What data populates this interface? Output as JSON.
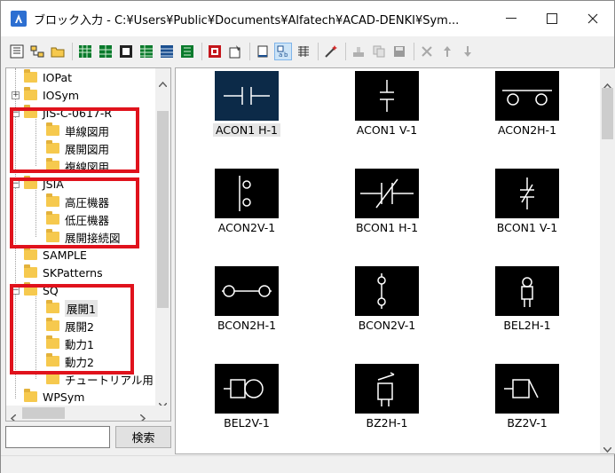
{
  "window": {
    "title": "ブロック入力 - C:¥Users¥Public¥Documents¥Alfatech¥ACAD-DENKI¥Sym...",
    "buttons": [
      "minimize",
      "maximize",
      "close"
    ]
  },
  "toolbar": {
    "icons": [
      "open-library-icon",
      "tree-icon",
      "folder-open-icon",
      "green-grid-icon-1",
      "green-grid-icon-2",
      "green-grid-icon-3",
      "green-grid-icon-4",
      "green-grid-icon-5",
      "green-grid-icon-6",
      "red-grid-icon",
      "properties-icon",
      "page-icon",
      "small-thumbnails-icon",
      "list-icon",
      "wand-icon",
      "stamp-icon",
      "copy-icon",
      "save-icon",
      "delete-icon",
      "up-arrow-icon",
      "down-arrow-icon"
    ]
  },
  "tree": {
    "items": [
      {
        "label": "IOPat",
        "level": 1
      },
      {
        "label": "IOSym",
        "level": 1
      },
      {
        "label": "JIS-C-0617-R",
        "level": 1
      },
      {
        "label": "単線図用",
        "level": 2
      },
      {
        "label": "展開図用",
        "level": 2
      },
      {
        "label": "複線図用",
        "level": 2
      },
      {
        "label": "JSIA",
        "level": 1
      },
      {
        "label": "高圧機器",
        "level": 2
      },
      {
        "label": "低圧機器",
        "level": 2
      },
      {
        "label": "展開接続図",
        "level": 2
      },
      {
        "label": "SAMPLE",
        "level": 1
      },
      {
        "label": "SKPatterns",
        "level": 1
      },
      {
        "label": "SQ",
        "level": 1
      },
      {
        "label": "展開1",
        "level": 2
      },
      {
        "label": "展開2",
        "level": 2
      },
      {
        "label": "動力1",
        "level": 2
      },
      {
        "label": "動力2",
        "level": 2
      },
      {
        "label": "チュートリアル用",
        "level": 2
      },
      {
        "label": "WPSym",
        "level": 1
      }
    ],
    "selected": "展開1"
  },
  "search": {
    "value": "",
    "button_label": "検索"
  },
  "grid": {
    "items": [
      {
        "label": "ACON1 H-1"
      },
      {
        "label": "ACON1 V-1"
      },
      {
        "label": "ACON2H-1"
      },
      {
        "label": "ACON2V-1"
      },
      {
        "label": "BCON1 H-1"
      },
      {
        "label": "BCON1 V-1"
      },
      {
        "label": "BCON2H-1"
      },
      {
        "label": "BCON2V-1"
      },
      {
        "label": "BEL2H-1"
      },
      {
        "label": "BEL2V-1"
      },
      {
        "label": "BZ2H-1"
      },
      {
        "label": "BZ2V-1"
      }
    ],
    "selected": "ACON1 H-1"
  },
  "colors": {
    "highlight_box": "#e0121c",
    "thumb_bg": "#000000",
    "thumb_selected_bg": "#0c2a48",
    "folder": "#f6c94e"
  }
}
